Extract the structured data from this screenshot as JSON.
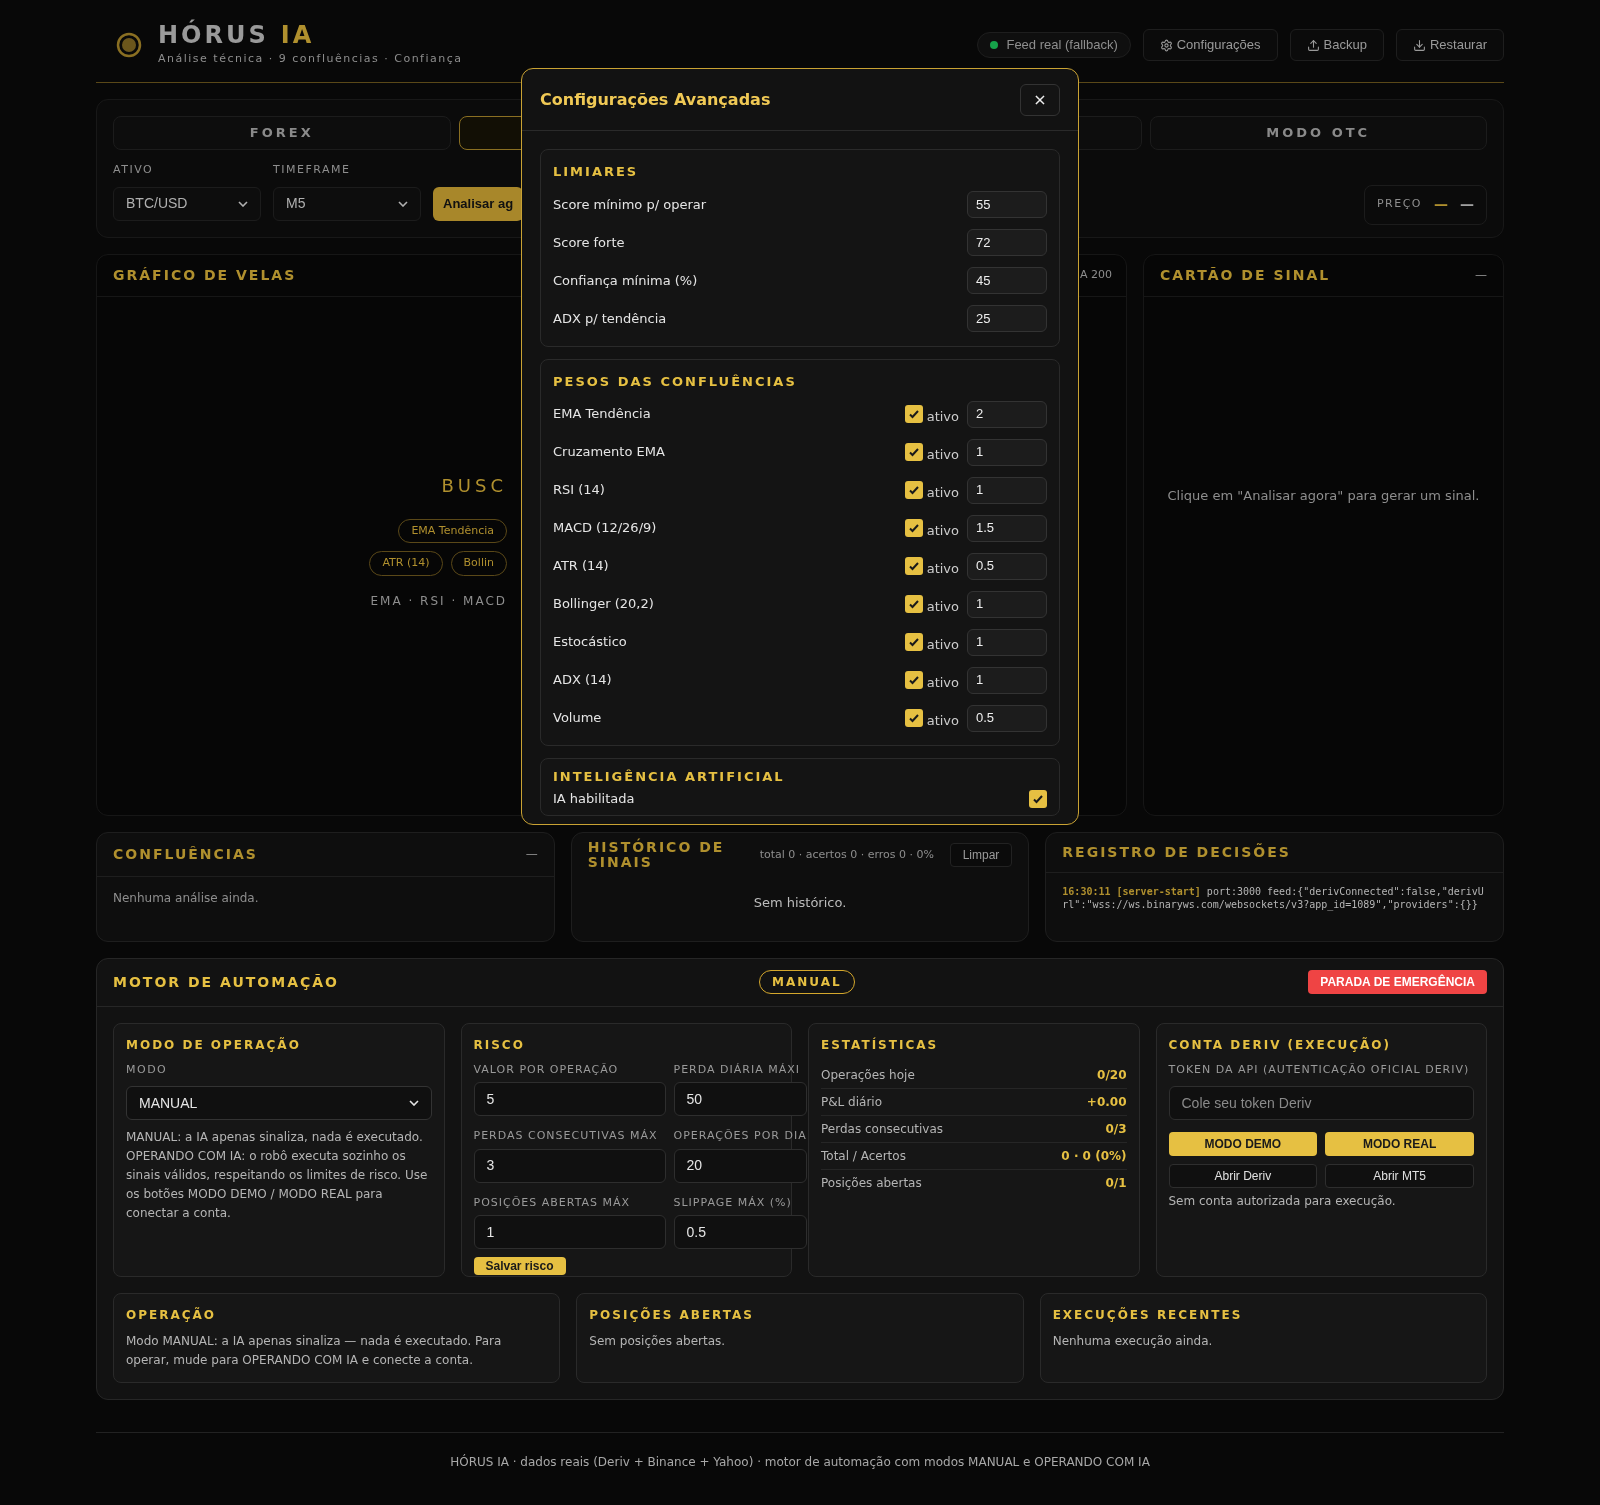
{
  "header": {
    "brand": "HÓRUS",
    "brand_accent": "IA",
    "subtitle": "Análise técnica · 9 confluências · Confiança",
    "feed": {
      "label": "Feed real (fallback)",
      "color": "#16a34a"
    },
    "buttons": [
      {
        "label": "Configurações"
      },
      {
        "label": "Backup"
      },
      {
        "label": "Restaurar"
      }
    ]
  },
  "market_tabs": [
    {
      "label": "FOREX",
      "selected": false
    },
    {
      "selected": true
    },
    {
      "selected": false
    },
    {
      "label": "MODO OTC",
      "selected": false
    }
  ],
  "controls": {
    "asset": {
      "label": "ATIVO",
      "value": "BTC/USD"
    },
    "timeframe": {
      "label": "TIMEFRAME",
      "value": "M5"
    },
    "analyze_button": "Analisar ag",
    "price": {
      "label": "PREÇO",
      "value": "—",
      "change": "—"
    }
  },
  "chart_panel": {
    "title": "GRÁFICO DE VELAS",
    "legend": "A 200",
    "status": "BUSC",
    "chips": [
      [
        "EMA Tendência"
      ],
      [
        "ATR (14)",
        "Bollin"
      ]
    ],
    "indicators": "EMA · RSI · MACD"
  },
  "signal_card": {
    "title": "CARTÃO DE SINAL",
    "badge": "—",
    "empty": "Clique em \"Analisar agora\" para gerar um sinal."
  },
  "confluences": {
    "title": "CONFLUÊNCIAS",
    "badge": "—",
    "empty": "Nenhuma análise ainda."
  },
  "history": {
    "title": "HISTÓRICO DE SINAIS",
    "summary": "total 0 · acertos 0 · erros 0 · 0%",
    "clear_button": "Limpar",
    "empty": "Sem histórico."
  },
  "decisions": {
    "title": "REGISTRO DE DECISÕES",
    "entries": [
      {
        "time": "16:30:11",
        "tag": "[server-start]",
        "message": "port:3000 feed:{\"derivConnected\":false,\"derivUrl\":\"wss://ws.binaryws.com/websockets/v3?app_id=1089\",\"providers\":{}}"
      }
    ]
  },
  "automation": {
    "title": "MOTOR DE AUTOMAÇÃO",
    "mode_badge": "MANUAL",
    "emergency_button": "PARADA DE EMERGÊNCIA",
    "operation_mode": {
      "title": "MODO DE OPERAÇÃO",
      "label": "MODO",
      "value": "MANUAL",
      "description": "MANUAL: a IA apenas sinaliza, nada é executado. OPERANDO COM IA: o robô executa sozinho os sinais válidos, respeitando os limites de risco. Use os botões MODO DEMO / MODO REAL para conectar a conta."
    },
    "risk": {
      "title": "RISCO",
      "fields": [
        {
          "label": "VALOR POR OPERAÇÃO",
          "value": "5"
        },
        {
          "label": "PERDA DIÁRIA MÁXI",
          "value": "50"
        },
        {
          "label": "PERDAS CONSECUTIVAS MÁX",
          "value": "3"
        },
        {
          "label": "OPERAÇÕES POR DIA",
          "value": "20"
        },
        {
          "label": "POSIÇÕES ABERTAS MÁX",
          "value": "1"
        },
        {
          "label": "SLIPPAGE MÁX (%)",
          "value": "0.5"
        }
      ],
      "save_button": "Salvar risco"
    },
    "stats": {
      "title": "ESTATÍSTICAS",
      "rows": [
        {
          "label": "Operações hoje",
          "value": "0/20"
        },
        {
          "label": "P&L diário",
          "value": "+0.00"
        },
        {
          "label": "Perdas consecutivas",
          "value": "0/3"
        },
        {
          "label": "Total / Acertos",
          "value": "0 · 0 (0%)"
        },
        {
          "label": "Posições abertas",
          "value": "0/1"
        }
      ]
    },
    "deriv": {
      "title": "CONTA DERIV (EXECUÇÃO)",
      "token_label": "TOKEN DA API (AUTENTICAÇÃO OFICIAL DERIV)",
      "token_placeholder": "Cole seu token Deriv",
      "buttons": [
        {
          "label": "MODO DEMO",
          "kind": "primary"
        },
        {
          "label": "MODO REAL",
          "kind": "primary"
        },
        {
          "label": "Abrir Deriv",
          "kind": "secondary"
        },
        {
          "label": "Abrir MT5",
          "kind": "secondary"
        }
      ],
      "status": "Sem conta autorizada para execução."
    },
    "panels": [
      {
        "title": "OPERAÇÃO",
        "text": "Modo MANUAL: a IA apenas sinaliza — nada é executado. Para operar, mude para OPERANDO COM IA e conecte a conta."
      },
      {
        "title": "POSIÇÕES ABERTAS",
        "text": "Sem posições abertas."
      },
      {
        "title": "EXECUÇÕES RECENTES",
        "text": "Nenhuma execução ainda."
      }
    ]
  },
  "footer": "HÓRUS IA · dados reais (Deriv + Binance + Yahoo) · motor de automação com modos MANUAL e OPERANDO COM IA",
  "modal": {
    "title": "Configurações Avançadas",
    "close": "×",
    "thresholds": {
      "title": "LIMIARES",
      "rows": [
        {
          "label": "Score mínimo p/ operar",
          "value": "55"
        },
        {
          "label": "Score forte",
          "value": "72"
        },
        {
          "label": "Confiança mínima (%)",
          "value": "45"
        },
        {
          "label": "ADX p/ tendência",
          "value": "25"
        }
      ]
    },
    "weights": {
      "title": "PESOS DAS CONFLUÊNCIAS",
      "rows": [
        {
          "label": "EMA Tendência",
          "checked": true,
          "check_label": "ativo",
          "value": "2"
        },
        {
          "label": "Cruzamento EMA",
          "checked": true,
          "check_label": "ativo",
          "value": "1"
        },
        {
          "label": "RSI (14)",
          "checked": true,
          "check_label": "ativo",
          "value": "1"
        },
        {
          "label": "MACD (12/26/9)",
          "checked": true,
          "check_label": "ativo",
          "value": "1.5"
        },
        {
          "label": "ATR (14)",
          "checked": true,
          "check_label": "ativo",
          "value": "0.5"
        },
        {
          "label": "Bollinger (20,2)",
          "checked": true,
          "check_label": "ativo",
          "value": "1"
        },
        {
          "label": "Estocástico",
          "checked": true,
          "check_label": "ativo",
          "value": "1"
        },
        {
          "label": "ADX (14)",
          "checked": true,
          "check_label": "ativo",
          "value": "1"
        },
        {
          "label": "Volume",
          "checked": true,
          "check_label": "ativo",
          "value": "0.5"
        }
      ]
    },
    "ai": {
      "title": "INTELIGÊNCIA ARTIFICIAL",
      "rows": [
        {
          "label": "IA habilitada",
          "checked": true
        }
      ]
    }
  }
}
